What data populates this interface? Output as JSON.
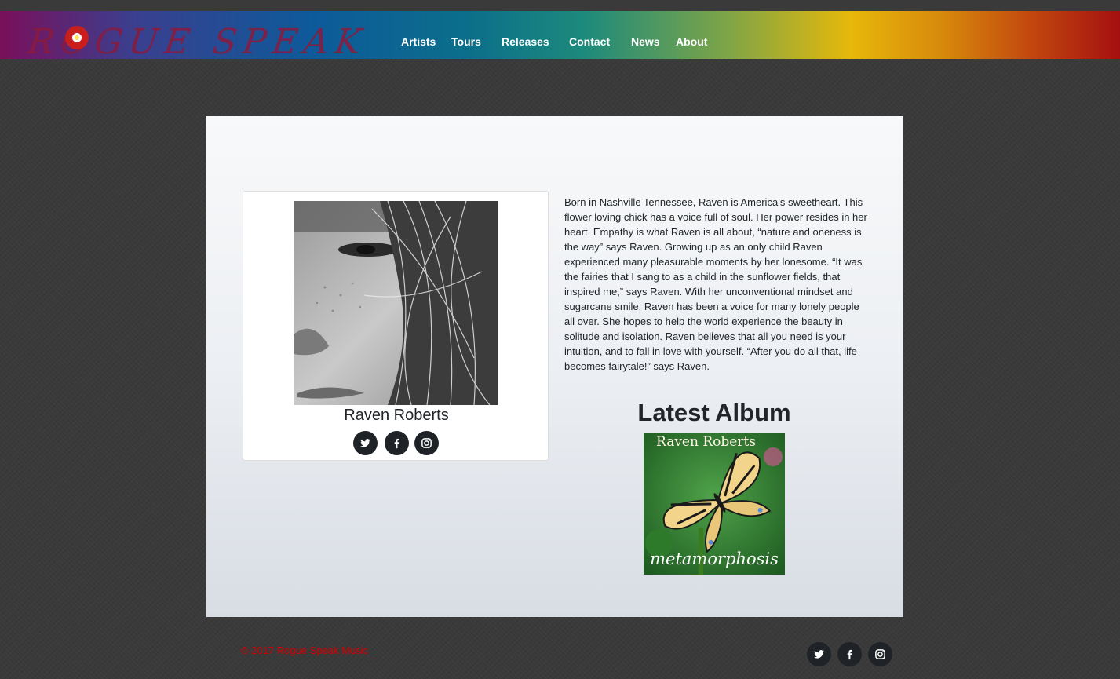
{
  "header": {
    "logo_text": "ROGUE SPEAK",
    "nav": [
      {
        "label": "Artists"
      },
      {
        "label": "Tours"
      },
      {
        "label": "Releases"
      },
      {
        "label": "Contact"
      },
      {
        "label": "News"
      },
      {
        "label": "About"
      }
    ]
  },
  "artist": {
    "name": "Raven Roberts",
    "social": [
      {
        "icon": "twitter-icon"
      },
      {
        "icon": "facebook-icon"
      },
      {
        "icon": "instagram-icon"
      }
    ],
    "bio": "Born in Nashville Tennessee, Raven is America’s sweetheart. This flower loving chick has a voice full of soul. Her power resides in her heart. Empathy is what Raven is all about, “nature and oneness is the way” says Raven. Growing up as an only child Raven experienced many pleasurable moments by her lonesome. “It was the fairies that I sang to as a child in the sunflower fields, that inspired me,” says Raven. With her unconventional mindset and sugarcane smile, Raven has been a voice for many lonely people all over. She hopes to help the world experience the beauty in solitude and isolation. Raven believes that all you need is your intuition, and to fall in love with yourself. “After you do all that, life becomes fairytale!” says Raven."
  },
  "album": {
    "heading": "Latest Album",
    "cover_artist": "Raven Roberts",
    "cover_title": "metamorphosis"
  },
  "footer": {
    "copyright": "© 2017 Rogue Speak Music",
    "social": [
      {
        "icon": "twitter-icon"
      },
      {
        "icon": "facebook-icon"
      },
      {
        "icon": "instagram-icon"
      }
    ]
  },
  "colors": {
    "footer_text": "#d40000",
    "social_button": "#1f2226"
  }
}
